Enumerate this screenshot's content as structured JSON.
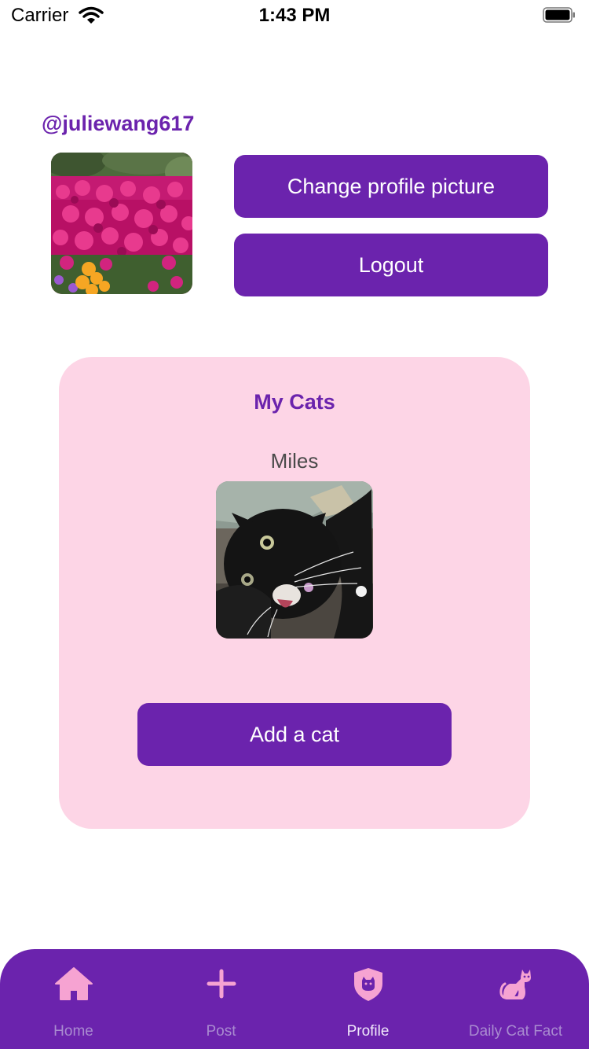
{
  "status_bar": {
    "carrier": "Carrier",
    "time": "1:43 PM"
  },
  "profile": {
    "username": "@juliewang617",
    "change_picture_label": "Change profile picture",
    "logout_label": "Logout"
  },
  "cats": {
    "title": "My Cats",
    "items": [
      {
        "name": "Miles"
      }
    ],
    "add_label": "Add a cat"
  },
  "tabs": [
    {
      "label": "Home",
      "icon": "home-icon"
    },
    {
      "label": "Post",
      "icon": "plus-icon"
    },
    {
      "label": "Profile",
      "icon": "shield-cat-icon",
      "active": true
    },
    {
      "label": "Daily Cat Fact",
      "icon": "cat-icon"
    }
  ],
  "colors": {
    "accent": "#6b23ad",
    "card": "#fdd5e6",
    "tab_icon": "#f6a3d2",
    "tab_label_inactive": "#a98bd0",
    "tab_label_active": "#f1e8fb"
  }
}
